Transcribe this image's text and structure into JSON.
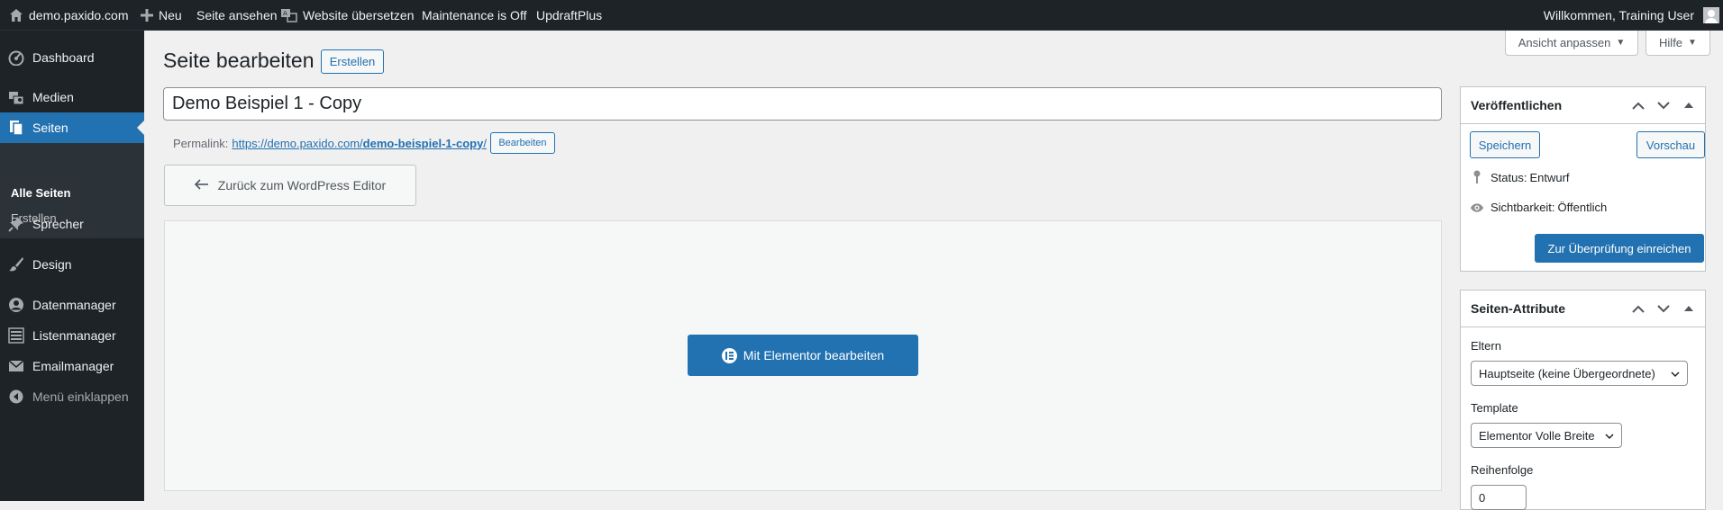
{
  "adminbar": {
    "site_name": "demo.paxido.com",
    "new_label": "Neu",
    "view_page": "Seite ansehen",
    "translate": "Website übersetzen",
    "maintenance": "Maintenance is Off",
    "updraft": "UpdraftPlus",
    "welcome": "Willkommen, Training User"
  },
  "sidebar": {
    "items": [
      {
        "label": "Dashboard",
        "icon": "dashboard-icon"
      },
      {
        "label": "Medien",
        "icon": "media-icon"
      },
      {
        "label": "Seiten",
        "icon": "pages-icon"
      },
      {
        "label": "Sprecher",
        "icon": "pin-icon"
      },
      {
        "label": "Design",
        "icon": "brush-icon"
      },
      {
        "label": "Datenmanager",
        "icon": "data-icon"
      },
      {
        "label": "Listenmanager",
        "icon": "list-icon"
      },
      {
        "label": "Emailmanager",
        "icon": "mail-icon"
      },
      {
        "label": "Menü einklappen",
        "icon": "collapse-icon"
      }
    ],
    "submenu": [
      "Alle Seiten",
      "Erstellen"
    ]
  },
  "header": {
    "title": "Seite bearbeiten",
    "add_new": "Erstellen",
    "screen_options": "Ansicht anpassen",
    "help": "Hilfe"
  },
  "editor": {
    "post_title": "Demo Beispiel 1 - Copy",
    "permalink_label": "Permalink:",
    "permalink_base": "https://demo.paxido.com/",
    "permalink_slug": "demo-beispiel-1-copy",
    "permalink_end": "/",
    "permalink_edit": "Bearbeiten",
    "back_button": "Zurück zum WordPress Editor",
    "elementor_button": "Mit Elementor bearbeiten"
  },
  "publish": {
    "title": "Veröffentlichen",
    "save": "Speichern",
    "preview": "Vorschau",
    "status_label": "Status:",
    "status_value": "Entwurf",
    "visibility_label": "Sichtbarkeit:",
    "visibility_value": "Öffentlich",
    "submit": "Zur Überprüfung einreichen"
  },
  "attributes": {
    "title": "Seiten-Attribute",
    "parent_label": "Eltern",
    "parent_value": "Hauptseite (keine Übergeordnete)",
    "template_label": "Template",
    "template_value": "Elementor Volle Breite",
    "order_label": "Reihenfolge",
    "order_value": "0"
  }
}
